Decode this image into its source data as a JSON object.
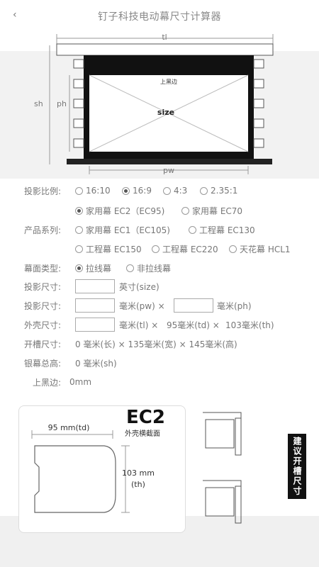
{
  "header": {
    "back_icon": "‹",
    "title": "钉子科技电动幕尺寸计算器"
  },
  "diagram": {
    "tl": "tl",
    "sh": "sh",
    "ph": "ph",
    "pw": "pw",
    "size": "size",
    "top_black": "上黑边"
  },
  "form": {
    "ratio": {
      "label": "投影比例:",
      "options": [
        "16:10",
        "16:9",
        "4:3",
        "2.35:1"
      ],
      "selected": "16:9"
    },
    "model": {
      "options": [
        "家用幕 EC2（EC95)",
        "家用幕 EC70"
      ],
      "selected": "家用幕 EC2（EC95)"
    },
    "series": {
      "label": "产品系列:",
      "options": [
        "家用幕 EC1（EC105)",
        "工程幕 EC130",
        "工程幕 EC150",
        "工程幕 EC220",
        "天花幕 HCL1"
      ]
    },
    "surface": {
      "label": "幕面类型:",
      "options": [
        "拉线幕",
        "非拉线幕"
      ],
      "selected": "拉线幕"
    },
    "size": {
      "label": "投影尺寸:",
      "unit": "英寸(size)"
    },
    "dims": {
      "label": "投影尺寸:",
      "unit_pw": "毫米(pw) ×",
      "unit_ph": "毫米(ph)"
    },
    "shell": {
      "label": "外壳尺寸:",
      "unit_tl": "毫米(tl) ×",
      "td": "95毫米(td) ×",
      "th": "103毫米(th)"
    },
    "slot": {
      "label": "开槽尺寸:",
      "value": "0 毫米(长) × 135毫米(宽) × 145毫米(高)"
    },
    "total": {
      "label": "银幕总高:",
      "value": "0 毫米(sh)"
    },
    "top_black": {
      "label": "上黑边:",
      "value": "0mm"
    }
  },
  "section": {
    "ec2": "EC2",
    "ec2_sub": "外壳横截面",
    "td_label": "95 mm(td)",
    "th_label": "103 mm",
    "th_sub": "(th)",
    "side_button": "建议开槽尺寸"
  }
}
